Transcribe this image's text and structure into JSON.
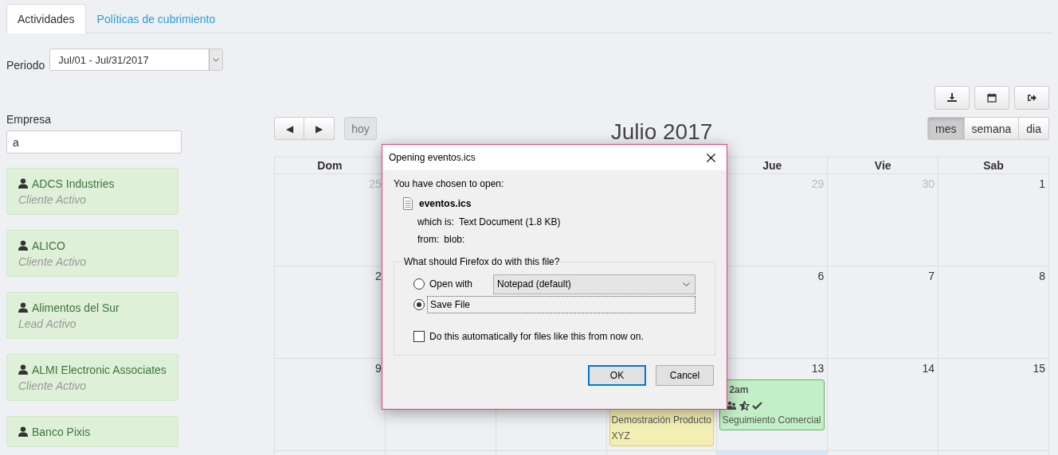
{
  "tabs": [
    {
      "label": "Actividades",
      "selected": true
    },
    {
      "label": "Políticas de cubrimiento",
      "selected": false
    }
  ],
  "period": {
    "label": "Periodo",
    "value": "Jul/01 - Jul/31/2017"
  },
  "company_filter": {
    "label": "Empresa",
    "value": "a"
  },
  "companies": [
    {
      "name": "ADCS Industries",
      "status": "Cliente Activo"
    },
    {
      "name": "ALICO",
      "status": "Cliente Activo"
    },
    {
      "name": "Alimentos del Sur",
      "status": "Lead Activo"
    },
    {
      "name": "ALMI Electronic Associates",
      "status": "Cliente Activo"
    },
    {
      "name": "Banco Pixis"
    }
  ],
  "calendar": {
    "nav_buttons": [
      "◀",
      "▶"
    ],
    "today_button": {
      "label": "hoy",
      "disabled": true
    },
    "title": "Julio 2017",
    "views": [
      {
        "label": "mes",
        "selected": true
      },
      {
        "label": "semana",
        "selected": false
      },
      {
        "label": "dia",
        "selected": false
      }
    ],
    "weekday_headers": {
      "sunday": "Dom",
      "thursday": "Jue",
      "friday": "Vie",
      "saturday": "Sab"
    },
    "weeks": [
      {
        "sunday": {
          "day": "25",
          "other_month": true
        },
        "thursday": {
          "day": "29",
          "other_month": true
        },
        "friday": {
          "day": "30",
          "other_month": true
        },
        "saturday": {
          "day": "1",
          "other_month": false
        }
      },
      {
        "sunday": {
          "day": "2",
          "other_month": false
        },
        "thursday": {
          "day": "6",
          "other_month": false
        },
        "friday": {
          "day": "7",
          "other_month": false
        },
        "saturday": {
          "day": "8",
          "other_month": false
        }
      },
      {
        "sunday": {
          "day": "9",
          "other_month": false
        },
        "wednesday": {
          "events": [
            {
              "title": "Demostración Producto XYZ",
              "color": "#f3efb4",
              "show_icons": false
            }
          ]
        },
        "thursday": {
          "day": "13",
          "other_month": false,
          "events": [
            {
              "time": "2am",
              "title": "Seguimiento Comercial",
              "color": "#c3efc6",
              "show_icons": true
            }
          ]
        },
        "friday": {
          "day": "14",
          "other_month": false
        },
        "saturday": {
          "day": "15",
          "other_month": false
        }
      },
      {
        "thursday": {
          "today": true
        }
      }
    ]
  },
  "dialog": {
    "title": "Opening eventos.ics",
    "intro": "You have chosen to open:",
    "file_name": "eventos.ics",
    "which_is_label": "which is:",
    "which_is": "Text Document (1.8 KB)",
    "from_label": "from:",
    "from": "blob:",
    "group_label": "What should Firefox do with this file?",
    "options": [
      {
        "label": "Open with",
        "selected": false,
        "app": "Notepad (default)"
      },
      {
        "label": "Save File",
        "selected": true
      }
    ],
    "auto_checkbox": {
      "label": "Do this automatically for files like this from now on.",
      "checked": false
    },
    "buttons": [
      {
        "label": "OK",
        "default": true
      },
      {
        "label": "Cancel",
        "default": false
      }
    ]
  }
}
